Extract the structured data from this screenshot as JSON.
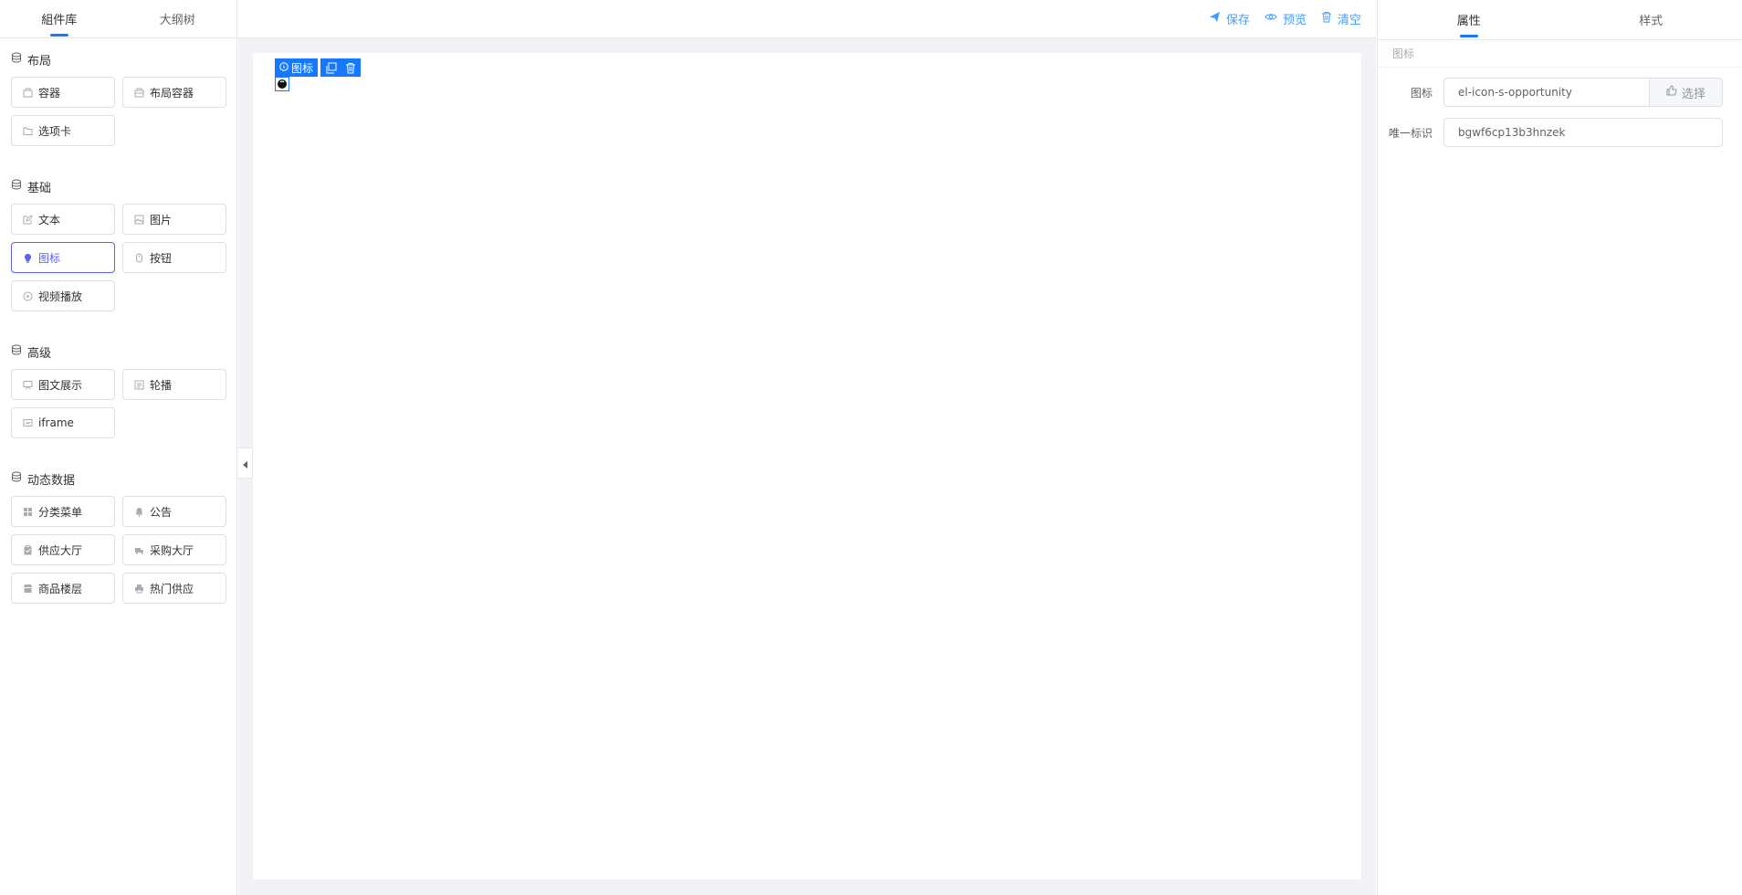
{
  "left_panel": {
    "tabs": [
      {
        "label": "組件库",
        "active": true
      },
      {
        "label": "大纲树",
        "active": false
      }
    ],
    "groups": [
      {
        "title": "布局",
        "icon": "database-icon",
        "items": [
          {
            "label": "容器",
            "icon": "box-icon"
          },
          {
            "label": "布局容器",
            "icon": "layout-box-icon"
          },
          {
            "label": "选项卡",
            "icon": "folder-icon"
          }
        ]
      },
      {
        "title": "基础",
        "icon": "database-icon",
        "items": [
          {
            "label": "文本",
            "icon": "edit-icon"
          },
          {
            "label": "图片",
            "icon": "picture-icon"
          },
          {
            "label": "图标",
            "icon": "opportunity-icon",
            "active": true
          },
          {
            "label": "按钮",
            "icon": "mouse-icon"
          },
          {
            "label": "视频播放",
            "icon": "video-play-icon"
          }
        ]
      },
      {
        "title": "高级",
        "icon": "database-icon",
        "items": [
          {
            "label": "图文展示",
            "icon": "board-icon"
          },
          {
            "label": "轮播",
            "icon": "news-icon"
          },
          {
            "label": "iframe",
            "icon": "monitor-icon"
          }
        ]
      },
      {
        "title": "动态数据",
        "icon": "database-icon",
        "items": [
          {
            "label": "分类菜单",
            "icon": "grid-icon"
          },
          {
            "label": "公告",
            "icon": "bell-icon"
          },
          {
            "label": "供应大厅",
            "icon": "clipboard-icon"
          },
          {
            "label": "采购大厅",
            "icon": "truck-icon"
          },
          {
            "label": "商品楼层",
            "icon": "shop-icon"
          },
          {
            "label": "热门供应",
            "icon": "printer-icon"
          }
        ]
      }
    ]
  },
  "toolbar": {
    "save_label": "保存",
    "preview_label": "预览",
    "clear_label": "清空"
  },
  "canvas": {
    "selected_label": "图标",
    "selected_icon": "opportunity-icon"
  },
  "right_panel": {
    "tabs": [
      {
        "label": "属性",
        "active": true
      },
      {
        "label": "样式",
        "active": false
      }
    ],
    "section_title": "图标",
    "fields": {
      "icon_label": "图标",
      "icon_value": "el-icon-s-opportunity",
      "select_label": "选择",
      "id_label": "唯一标识",
      "id_value": "bgwf6cp13b3hnzek"
    }
  },
  "colors": {
    "accent": "#1677ff",
    "active_component": "#5b63e8",
    "border": "#dcdfe6",
    "canvas_bg": "#f0f2f5"
  }
}
